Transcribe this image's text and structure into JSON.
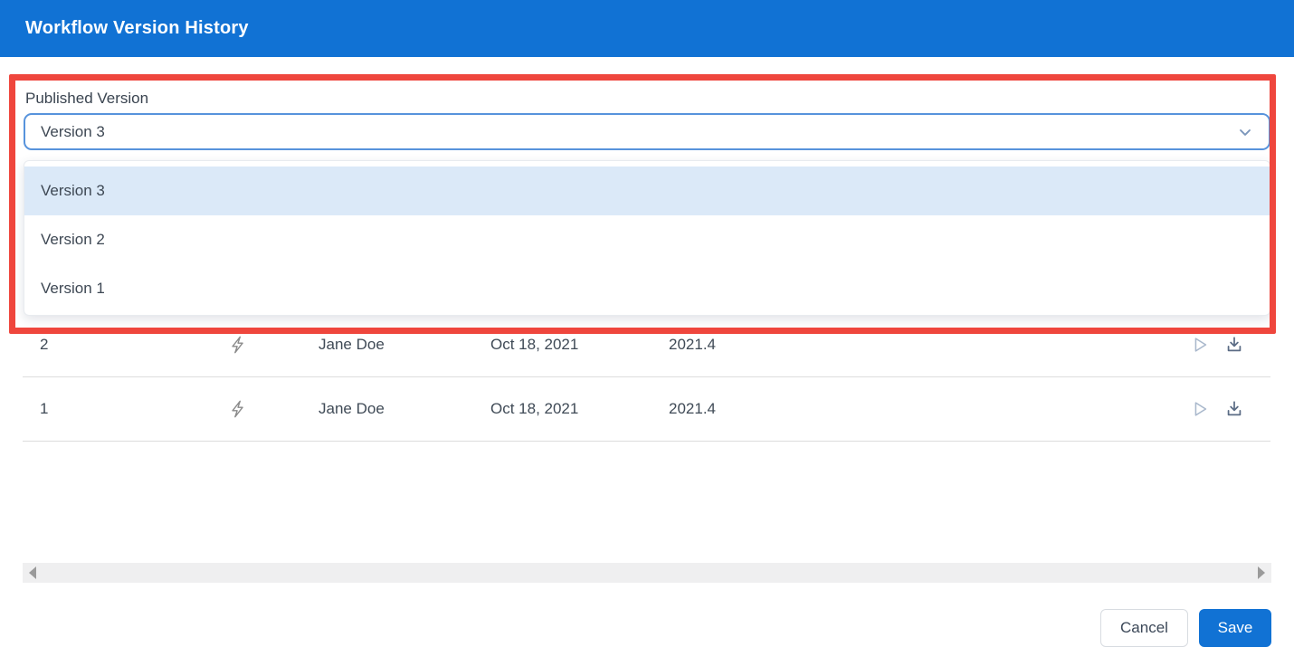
{
  "dialog": {
    "title": "Workflow Version History"
  },
  "published_version": {
    "label": "Published Version",
    "selected": "Version 3",
    "options": [
      "Version 3",
      "Version 2",
      "Version 1"
    ]
  },
  "table": {
    "rows": [
      {
        "version": "2",
        "author": "Jane Doe",
        "date": "Oct 18, 2021",
        "release": "2021.4"
      },
      {
        "version": "1",
        "author": "Jane Doe",
        "date": "Oct 18, 2021",
        "release": "2021.4"
      }
    ]
  },
  "footer": {
    "cancel_label": "Cancel",
    "save_label": "Save"
  },
  "icons": {
    "dropdown": "chevron-down-icon",
    "row_trigger": "lightning-icon",
    "row_run": "play-icon",
    "row_download": "download-icon",
    "scroll_left": "scroll-left-arrow-icon",
    "scroll_right": "scroll-right-arrow-icon"
  },
  "colors": {
    "header_blue": "#1172d4",
    "save_blue": "#1172d4",
    "select_border_blue": "#5793dc",
    "option_highlight_blue": "#dbe9f8",
    "annotation_red": "#ef463d"
  }
}
